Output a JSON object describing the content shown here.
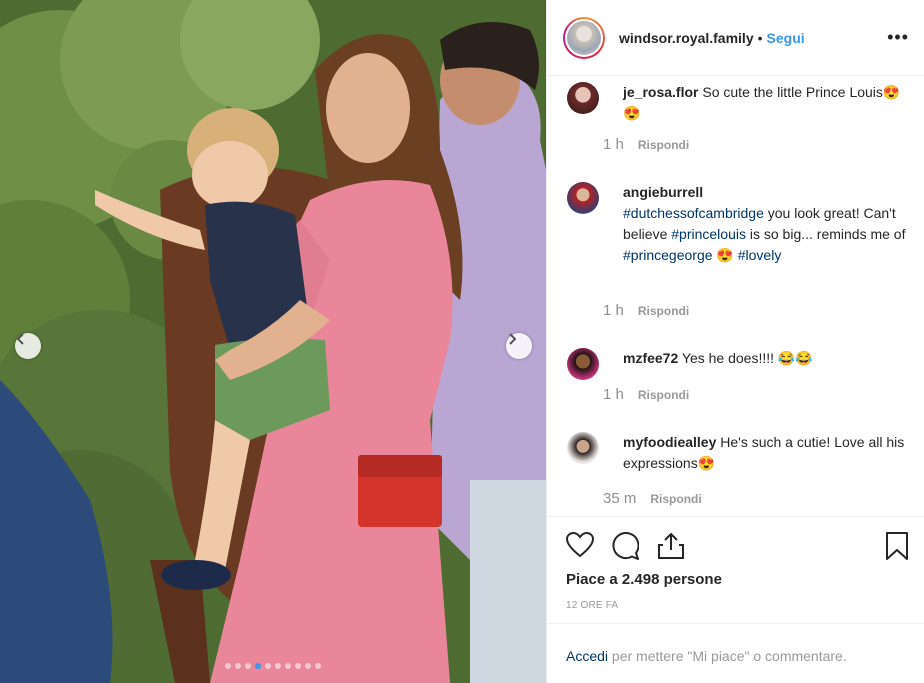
{
  "post": {
    "username": "windsor.royal.family",
    "bullet": "•",
    "follow_label": "Segui",
    "more_label": "•••"
  },
  "comments": [
    {
      "user": "je_rosa.flor",
      "text": " So cute the little Prince Louis😍😍",
      "time": "1 h",
      "reply": "Rispondi"
    },
    {
      "user": "angieburrell",
      "parts": [
        {
          "text": "#dutchessofcambridge",
          "tag": true
        },
        {
          "text": " you look great! Can't believe ",
          "tag": false
        },
        {
          "text": "#princelouis",
          "tag": true
        },
        {
          "text": " is so big... reminds me of ",
          "tag": false
        },
        {
          "text": "#princegeorge",
          "tag": true
        },
        {
          "text": " 😍 ",
          "tag": false
        },
        {
          "text": "#lovely",
          "tag": true
        }
      ],
      "time": "1 h",
      "reply": "Rispondi"
    },
    {
      "user": "mzfee72",
      "text": " Yes he does!!!! 😂😂",
      "time": "1 h",
      "reply": "Rispondi"
    },
    {
      "user": "myfoodiealley",
      "text": " He's such a cutie! Love all his expressions😍",
      "time": "35 m",
      "reply": "Rispondi"
    }
  ],
  "footer": {
    "likes": "Piace a 2.498 persone",
    "ago": "12 ORE FA",
    "login_link": "Accedi",
    "login_text": " per mettere \"Mi piace\" o commentare."
  },
  "carousel": {
    "dot_count": 10,
    "active_index": 3
  },
  "colors": {
    "accent": "#3897f0",
    "hashtag": "#003569",
    "muted": "#999999"
  },
  "icons": [
    "chevron-left-icon",
    "chevron-right-icon",
    "heart-icon",
    "comment-icon",
    "share-icon",
    "bookmark-icon",
    "more-icon"
  ]
}
